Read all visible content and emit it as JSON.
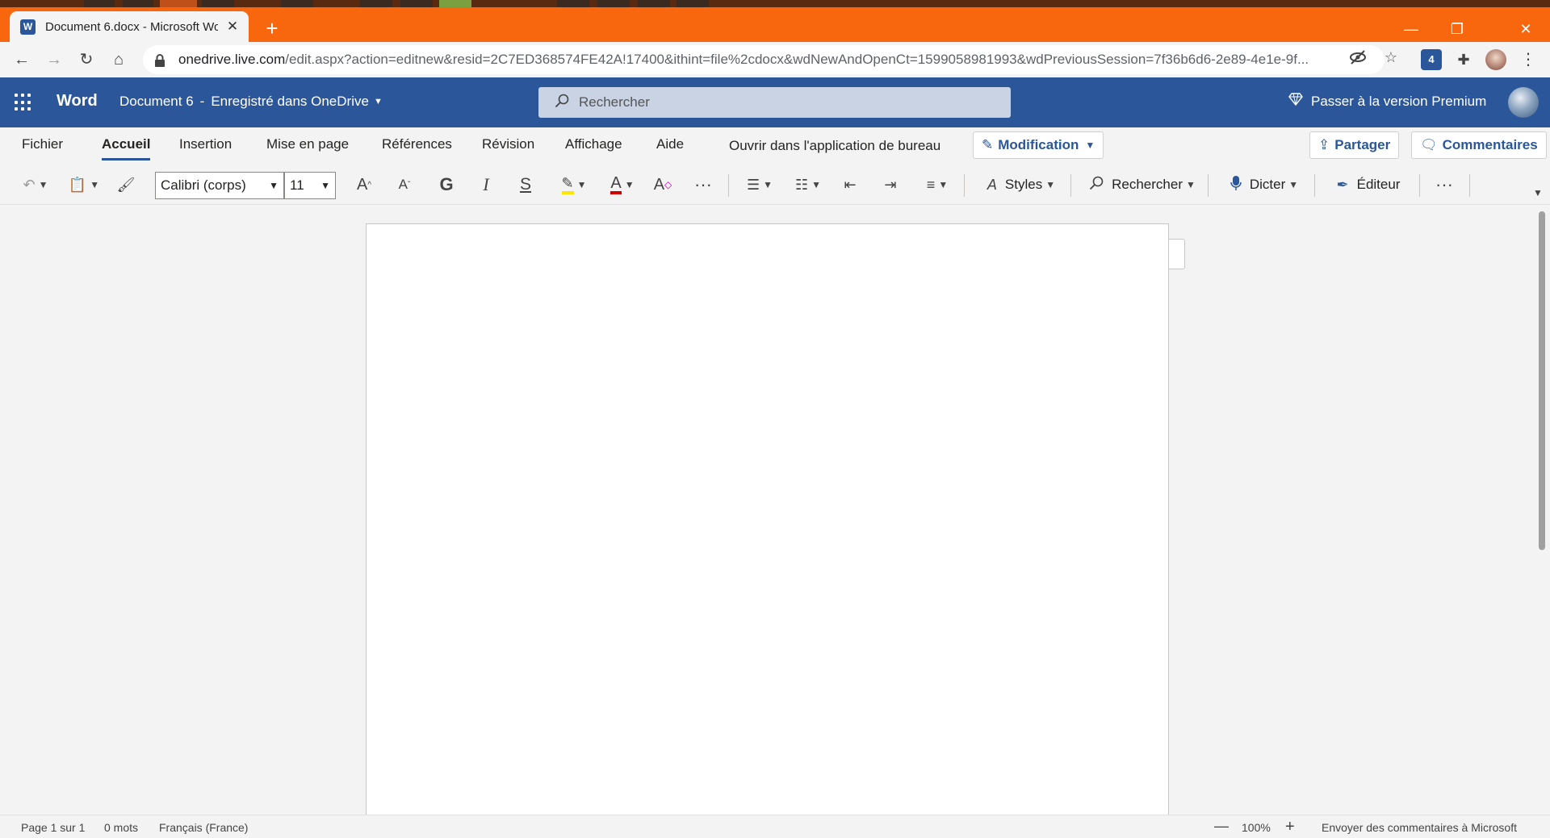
{
  "browser": {
    "tab_title": "Document 6.docx - Microsoft Wo",
    "url_host": "onedrive.live.com",
    "url_path": "/edit.aspx?action=editnew&resid=2C7ED368574FE42A!17400&ithint=file%2cdocx&wdNewAndOpenCt=1599058981993&wdPreviousSession=7f36b6d6-2e89-4e1e-9f...",
    "extension_badge": "4",
    "accent_color": "#f8660d"
  },
  "header": {
    "app_name": "Word",
    "doc_name": "Document 6",
    "separator": "-",
    "save_status": "Enregistré dans OneDrive",
    "search_placeholder": "Rechercher",
    "premium_label": "Passer à la version Premium",
    "brand_color": "#2b579a"
  },
  "ribbon": {
    "tabs": [
      {
        "label": "Fichier"
      },
      {
        "label": "Accueil",
        "active": true
      },
      {
        "label": "Insertion"
      },
      {
        "label": "Mise en page"
      },
      {
        "label": "Références"
      },
      {
        "label": "Révision"
      },
      {
        "label": "Affichage"
      },
      {
        "label": "Aide"
      },
      {
        "label": "Ouvrir dans l'application de bureau"
      }
    ],
    "mode_label": "Modification",
    "share_label": "Partager",
    "comments_label": "Commentaires"
  },
  "toolbar": {
    "font_name": "Calibri (corps)",
    "font_size": "11",
    "bold_glyph": "G",
    "italic_glyph": "I",
    "underline_glyph": "S",
    "styles_label": "Styles",
    "find_label": "Rechercher",
    "dictate_label": "Dicter",
    "editor_label": "Éditeur"
  },
  "status": {
    "page": "Page 1 sur 1",
    "words": "0 mots",
    "language": "Français (France)",
    "zoom": "100%",
    "feedback": "Envoyer des commentaires à Microsoft"
  }
}
